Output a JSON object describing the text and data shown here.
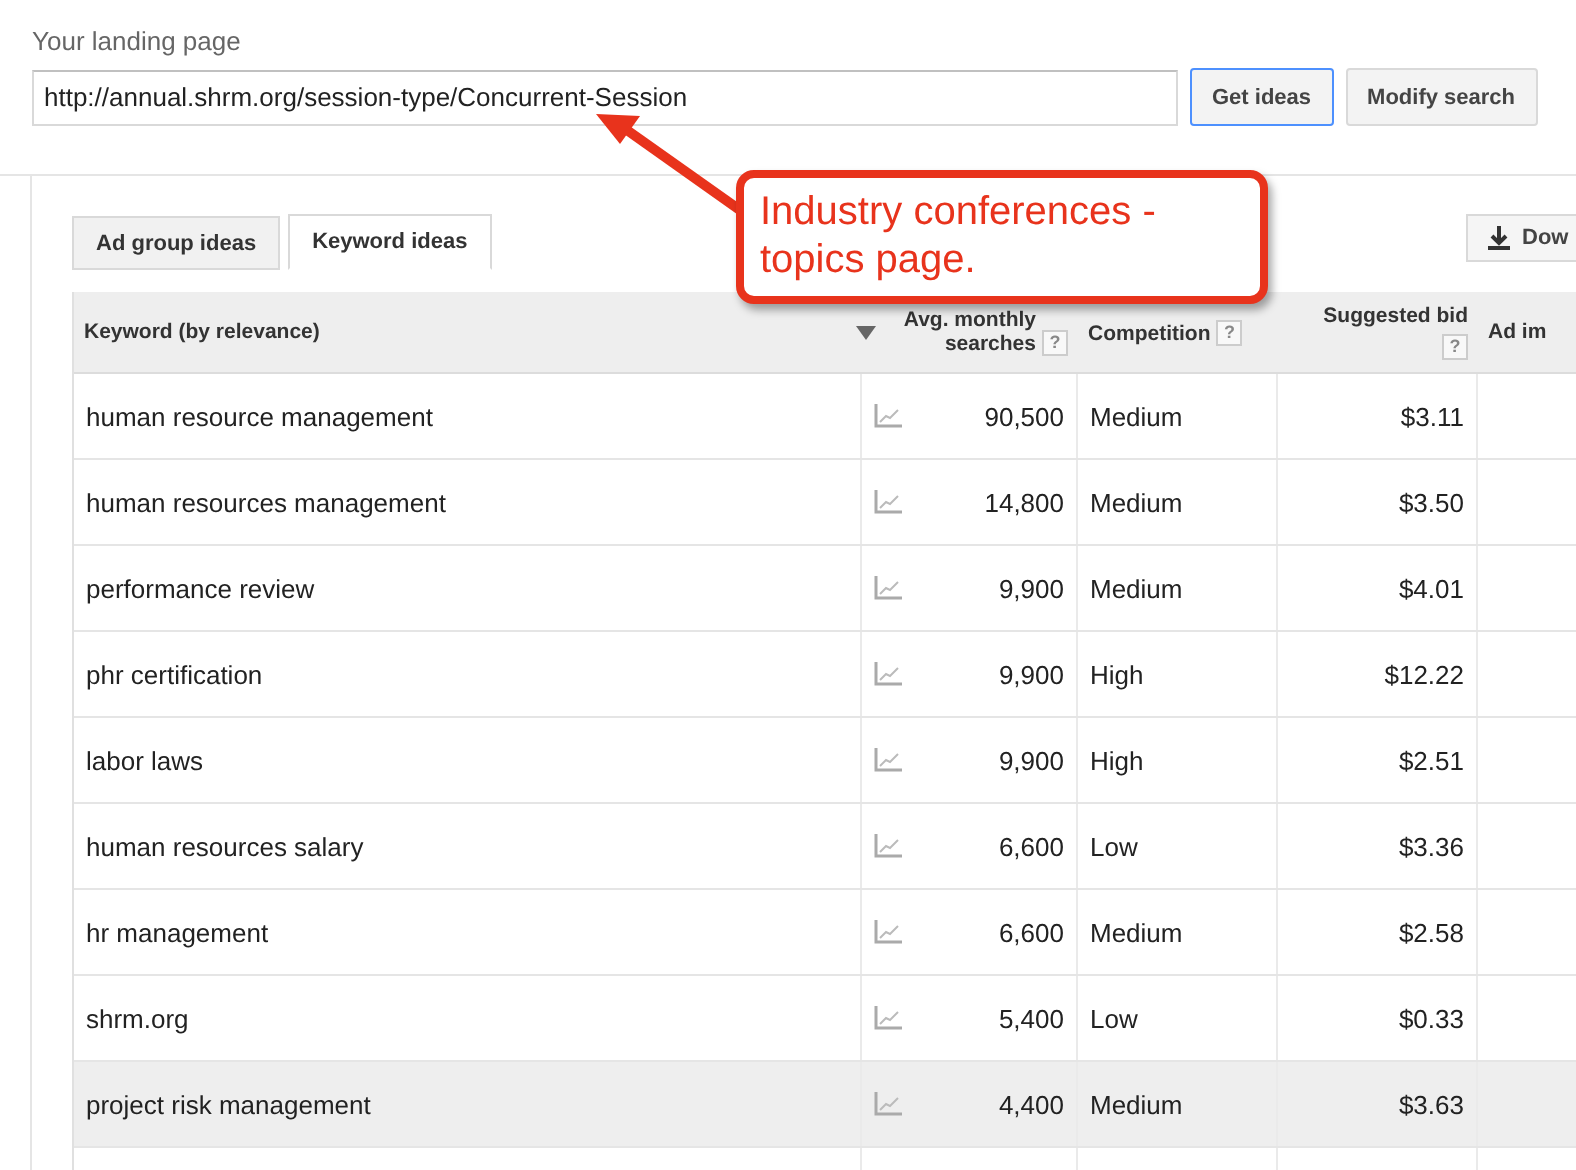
{
  "landing_page": {
    "label": "Your landing page",
    "value": "http://annual.shrm.org/session-type/Concurrent-Session"
  },
  "buttons": [
    {
      "label": "Get ideas",
      "primary": true
    },
    {
      "label": "Modify search",
      "primary": false
    }
  ],
  "tabs": [
    {
      "label": "Ad group ideas",
      "selected": false
    },
    {
      "label": "Keyword ideas",
      "selected": true
    }
  ],
  "download_button": {
    "label": "Dow"
  },
  "callout": {
    "text": "Industry conferences - topics page."
  },
  "table": {
    "columns": [
      {
        "label": "Keyword (by relevance)",
        "sorted": false
      },
      {
        "label": "Avg. monthly searches",
        "sorted": true,
        "help": "?"
      },
      {
        "label": "Competition",
        "sorted": false,
        "help": "?"
      },
      {
        "label": "Suggested bid",
        "sorted": false,
        "help": "?"
      },
      {
        "label": "Ad im",
        "sorted": false
      }
    ],
    "rows": [
      {
        "keyword": "human resource management",
        "searches": "90,500",
        "competition": "Medium",
        "bid": "$3.11",
        "hovered": false
      },
      {
        "keyword": "human resources management",
        "searches": "14,800",
        "competition": "Medium",
        "bid": "$3.50",
        "hovered": false
      },
      {
        "keyword": "performance review",
        "searches": "9,900",
        "competition": "Medium",
        "bid": "$4.01",
        "hovered": false
      },
      {
        "keyword": "phr certification",
        "searches": "9,900",
        "competition": "High",
        "bid": "$12.22",
        "hovered": false
      },
      {
        "keyword": "labor laws",
        "searches": "9,900",
        "competition": "High",
        "bid": "$2.51",
        "hovered": false
      },
      {
        "keyword": "human resources salary",
        "searches": "6,600",
        "competition": "Low",
        "bid": "$3.36",
        "hovered": false
      },
      {
        "keyword": "hr management",
        "searches": "6,600",
        "competition": "Medium",
        "bid": "$2.58",
        "hovered": false
      },
      {
        "keyword": "shrm.org",
        "searches": "5,400",
        "competition": "Low",
        "bid": "$0.33",
        "hovered": false
      },
      {
        "keyword": "project risk management",
        "searches": "4,400",
        "competition": "Medium",
        "bid": "$3.63",
        "hovered": true
      }
    ]
  }
}
